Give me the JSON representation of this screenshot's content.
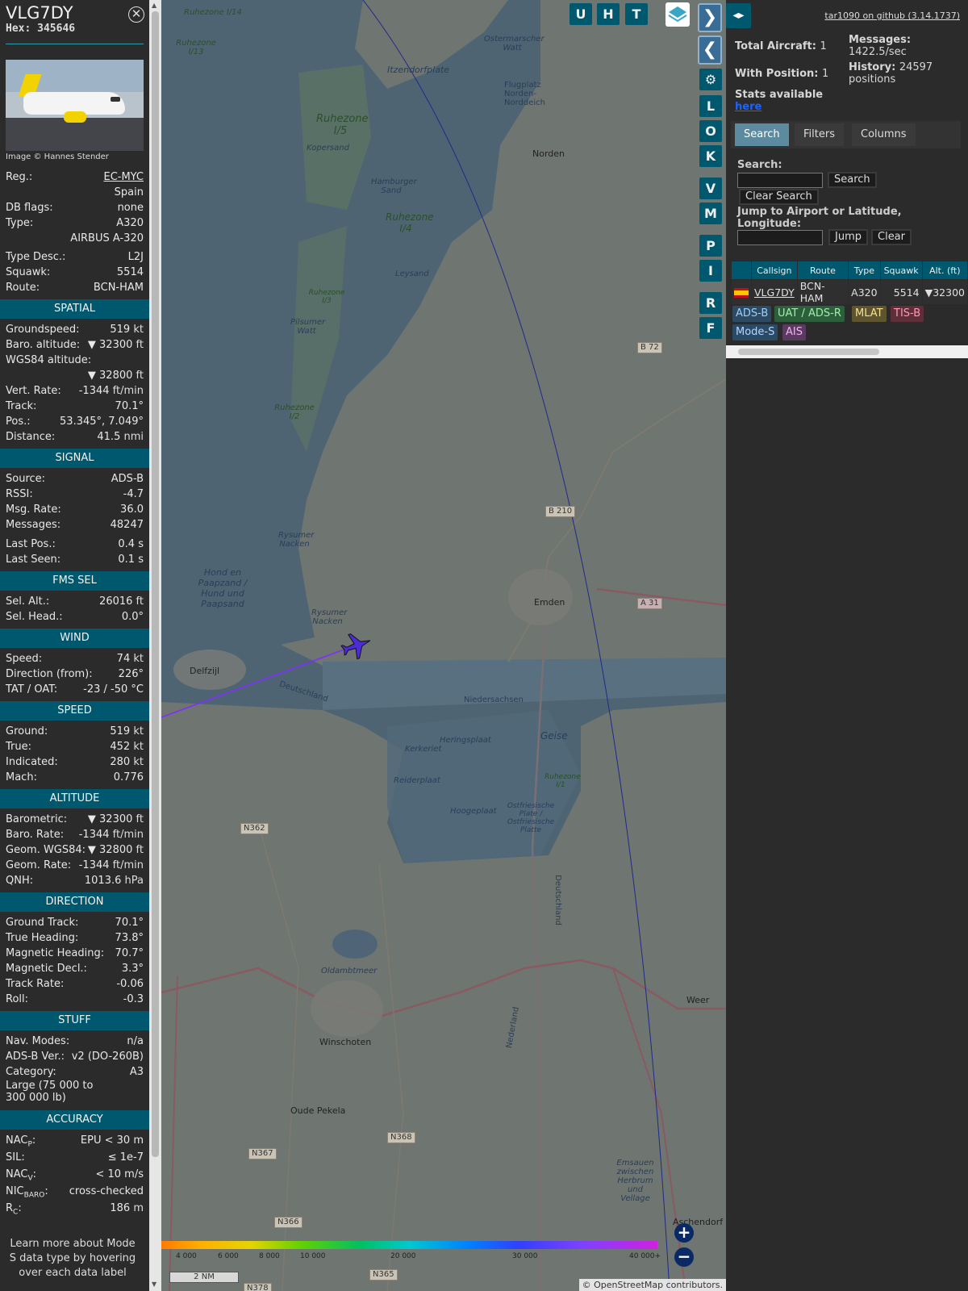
{
  "info": {
    "callsign": "VLG7DY",
    "hex_label": "Hex:",
    "hex": "345646",
    "photo_credit": "Image © Hannes Stender",
    "reg_label": "Reg.:",
    "reg": "EC-MYC",
    "country": "Spain",
    "dbflags_label": "DB flags:",
    "dbflags": "none",
    "type_label": "Type:",
    "type": "A320",
    "type_name": "AIRBUS A-320",
    "typedesc_label": "Type Desc.:",
    "typedesc": "L2J",
    "squawk_label": "Squawk:",
    "squawk": "5514",
    "route_label": "Route:",
    "route": "BCN-HAM",
    "spatial": {
      "title": "SPATIAL",
      "gs_label": "Groundspeed:",
      "gs": "519",
      "gs_unit": "kt",
      "baro_label": "Baro. altitude:",
      "baro": "▼ 32300",
      "baro_unit": "ft",
      "wgs_label": "WGS84 altitude:",
      "wgs": "▼ 32800",
      "wgs_unit": "ft",
      "vr_label": "Vert. Rate:",
      "vr": "-1344",
      "vr_unit": "ft/min",
      "track_label": "Track:",
      "track": "70.1°",
      "pos_label": "Pos.:",
      "pos": "53.345°, 7.049°",
      "dist_label": "Distance:",
      "dist": "41.5",
      "dist_unit": "nmi"
    },
    "signal": {
      "title": "SIGNAL",
      "source_label": "Source:",
      "source": "ADS-B",
      "rssi_label": "RSSI:",
      "rssi": "-4.7",
      "msgrate_label": "Msg. Rate:",
      "msgrate": "36.0",
      "messages_label": "Messages:",
      "messages": "48247",
      "lastpos_label": "Last Pos.:",
      "lastpos": "0.4 s",
      "lastseen_label": "Last Seen:",
      "lastseen": "0.1 s"
    },
    "fms": {
      "title": "FMS SEL",
      "selalt_label": "Sel. Alt.:",
      "selalt": "26016",
      "selalt_unit": "ft",
      "selhead_label": "Sel. Head.:",
      "selhead": "0.0°"
    },
    "wind": {
      "title": "WIND",
      "speed_label": "Speed:",
      "speed": "74",
      "speed_unit": "kt",
      "dir_label": "Direction (from):",
      "dir": "226°",
      "tat_label": "TAT / OAT:",
      "tat": "-23 / -50 °C"
    },
    "speed": {
      "title": "SPEED",
      "ground_label": "Ground:",
      "ground": "519",
      "ground_unit": "kt",
      "true_label": "True:",
      "true": "452",
      "true_unit": "kt",
      "ind_label": "Indicated:",
      "ind": "280",
      "ind_unit": "kt",
      "mach_label": "Mach:",
      "mach": "0.776"
    },
    "altitude": {
      "title": "ALTITUDE",
      "baro_label": "Barometric:",
      "baro": "▼ 32300",
      "baro_unit": "ft",
      "barorate_label": "Baro. Rate:",
      "barorate": "-1344",
      "barorate_unit": "ft/min",
      "geom_label": "Geom. WGS84:",
      "geom": "▼ 32800",
      "geom_unit": "ft",
      "geomrate_label": "Geom. Rate:",
      "geomrate": "-1344",
      "geomrate_unit": "ft/min",
      "qnh_label": "QNH:",
      "qnh": "1013.6",
      "qnh_unit": "hPa"
    },
    "direction": {
      "title": "DIRECTION",
      "gt_label": "Ground Track:",
      "gt": "70.1°",
      "th_label": "True Heading:",
      "th": "73.8°",
      "mh_label": "Magnetic Heading:",
      "mh": "70.7°",
      "md_label": "Magnetic Decl.:",
      "md": "3.3°",
      "tr_label": "Track Rate:",
      "tr": "-0.06",
      "roll_label": "Roll:",
      "roll": "-0.3"
    },
    "stuff": {
      "title": "STUFF",
      "nav_label": "Nav. Modes:",
      "nav": "n/a",
      "adsb_label": "ADS-B Ver.:",
      "adsb": "v2 (DO-260B)",
      "cat_label": "Category:",
      "cat": "A3",
      "cat_desc": "Large (75 000 to 300 000 lb)"
    },
    "accuracy": {
      "title": "ACCURACY",
      "nacp_label": "NAC",
      "nacp_sub": "P",
      "nacp": "EPU < 30 m",
      "sil_label": "SIL:",
      "sil": "≤ 1e-7",
      "nacv_label": "NAC",
      "nacv_sub": "V",
      "nacv": "< 10 m/s",
      "nic_label": "NIC",
      "nic_sub": "BARO",
      "nic": "cross-checked",
      "rc_label": "R",
      "rc_sub": "C",
      "rc": "186",
      "rc_unit": "m"
    },
    "learn": "Learn more about Mode S data type by hovering over each data label"
  },
  "map": {
    "toolbar": {
      "u": "U",
      "h": "H",
      "t": "T"
    },
    "side_buttons": [
      "L",
      "O",
      "K",
      "V",
      "M",
      "P",
      "I",
      "R",
      "F"
    ],
    "labels": {
      "ruhezone_i14": "Ruhezone I/14",
      "ruhezone_i13": "Ruhezone I/13",
      "ruhezone_i5": "Ruhezone I/5",
      "ruhezone_i4": "Ruhezone I/4",
      "ruhezone_i3": "Ruhezone I/3",
      "ruhezone_i2": "Ruhezone I/2",
      "ruhezone_i1": "Ruhezone I/1",
      "ostermarscher": "Ostermarscher Watt",
      "itzendorfplate": "Itzendorfplate",
      "flugplatz": "Flugplatz Norden-Norddeich",
      "kopersand": "Kopersand",
      "hamburger": "Hamburger Sand",
      "leysand": "Leysand",
      "pilsumer": "Pilsumer Watt",
      "rysumer_nacken": "Rysumer Nacken",
      "hund": "Hond en Paapzand / Hund und Paapsand",
      "rysumer_nacken2": "Rysumer Nacken",
      "deutschland": "Deutschland",
      "niedersachsen": "Niedersachsen",
      "heringsplaat": "Heringsplaat",
      "kerkeriet": "Kerkeriet",
      "geise": "Geise",
      "reiderplaat": "Reiderplaat",
      "hoogeplaat": "Hoogeplaat",
      "ostfriesische": "Ostfriesische Plate / Ostfriesische Platte",
      "oldambtmeer": "Oldambtmeer",
      "deutschland2": "Deutschland",
      "nederland": "Nederland",
      "emsauen": "Emsauen zwischen Herbrum und Vellage",
      "norden": "Norden",
      "emden": "Emden",
      "delfzijl": "Delfzijl",
      "winschoten": "Winschoten",
      "oude_pekela": "Oude Pekela",
      "aschendorf": "Aschendorf",
      "weer": "Weer"
    },
    "roads": {
      "b72": "B 72",
      "b210": "B 210",
      "a31": "A 31",
      "n362": "N362",
      "n368": "N368",
      "n367": "N367",
      "n366": "N366",
      "n365": "N365",
      "n378": "N378"
    },
    "altitude_ticks": [
      "4 000",
      "6 000",
      "8 000",
      "10 000",
      "20 000",
      "30 000",
      "40 000+"
    ],
    "scale": "2 NM",
    "attribution": "© OpenStreetMap contributors."
  },
  "right": {
    "github_link": "tar1090 on github (3.14.1737)",
    "total_label": "Total Aircraft:",
    "total": "1",
    "withpos_label": "With Position:",
    "withpos": "1",
    "messages_label": "Messages:",
    "messages_rate": "1422.5/sec",
    "history_label": "History:",
    "history": "24597 positions",
    "stats_label": "Stats available",
    "stats_link": "here",
    "tabs": [
      "Search",
      "Filters",
      "Columns"
    ],
    "search_label": "Search:",
    "search_button": "Search",
    "clear_search": "Clear Search",
    "jump_label": "Jump to Airport or Latitude, Longitude:",
    "jump_button": "Jump",
    "clear_button": "Clear",
    "table": {
      "headers": [
        "",
        "Callsign",
        "Route",
        "Type",
        "Squawk",
        "Alt. (ft)"
      ],
      "rows": [
        {
          "callsign": "VLG7DY",
          "route": "BCN-HAM",
          "type": "A320",
          "squawk": "5514",
          "alt": "▼32300"
        }
      ]
    },
    "legend": [
      "ADS-B",
      "UAT / ADS-R",
      "MLAT",
      "TIS-B",
      "Mode-S",
      "AIS"
    ],
    "colors": {
      "accent": "#00586e",
      "adsb": "#2e4a62",
      "uat": "#2e5f3d",
      "mlat": "#5e5430",
      "tisb": "#5e2e3a",
      "modes": "#2a4a66",
      "ais": "#5a3a5e"
    }
  }
}
